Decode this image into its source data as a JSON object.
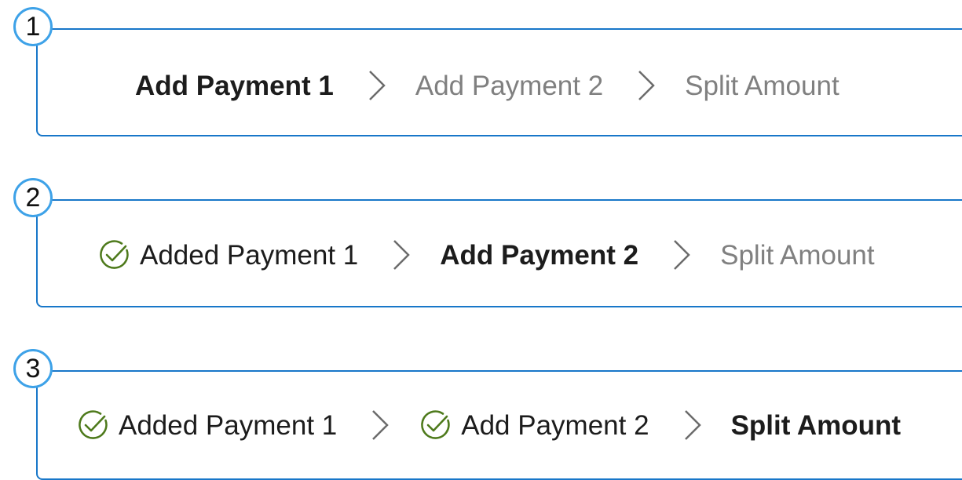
{
  "panels": [
    {
      "marker": "1",
      "steps": [
        {
          "label": "Add Payment 1",
          "state": "active"
        },
        {
          "label": "Add Payment 2",
          "state": "pending"
        },
        {
          "label": "Split Amount",
          "state": "pending"
        }
      ]
    },
    {
      "marker": "2",
      "steps": [
        {
          "label": "Added Payment 1",
          "state": "done"
        },
        {
          "label": "Add Payment 2",
          "state": "active"
        },
        {
          "label": "Split Amount",
          "state": "pending"
        }
      ]
    },
    {
      "marker": "3",
      "steps": [
        {
          "label": "Added Payment 1",
          "state": "done"
        },
        {
          "label": "Add Payment 2",
          "state": "done"
        },
        {
          "label": "Split Amount",
          "state": "active"
        }
      ]
    }
  ],
  "icons": {
    "completed": "check-circle-icon",
    "separator": "chevron-right-icon"
  },
  "colors": {
    "frame": "#1877c9",
    "marker_ring": "#3ea2e8",
    "check": "#4e7a1c",
    "active_text": "#1c1c1c",
    "pending_text": "#808080",
    "chevron": "#6b6b6b"
  }
}
